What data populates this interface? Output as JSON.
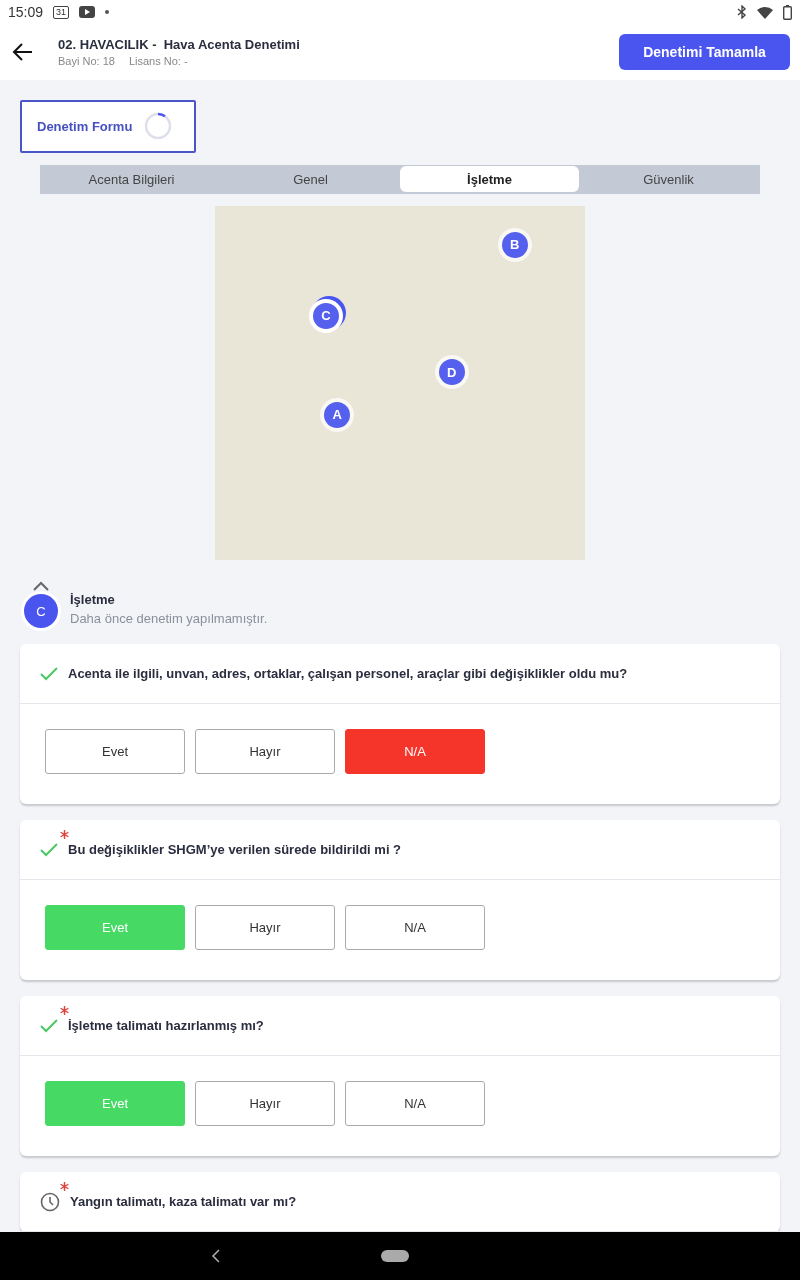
{
  "status_bar": {
    "time": "15:09",
    "calendar_day": "31"
  },
  "header": {
    "title": "02. HAVACILIK -  Hava Acenta Denetimi",
    "bayi": "Bayi No: 18",
    "lisans": "Lisans No: -",
    "action": "Denetimi Tamamla"
  },
  "form_button": {
    "label": "Denetim Formu"
  },
  "tabs": [
    {
      "label": "Acenta Bilgileri",
      "selected": false
    },
    {
      "label": "Genel",
      "selected": false
    },
    {
      "label": "İşletme",
      "selected": true
    },
    {
      "label": "Güvenlik",
      "selected": false
    }
  ],
  "map": {
    "pins": [
      {
        "label": "B",
        "active": false
      },
      {
        "label": "C",
        "active": true
      },
      {
        "label": "D",
        "active": false
      },
      {
        "label": "A",
        "active": false
      }
    ]
  },
  "section": {
    "title": "İşletme",
    "badge": "C",
    "subtitle": "Daha önce denetim yapılmamıştır.",
    "expanded": true
  },
  "questions": [
    {
      "answered": true,
      "required": false,
      "text": "Acenta ile ilgili, unvan, adres, ortaklar, çalışan personel, araçlar gibi değişiklikler oldu mu?",
      "options": [
        {
          "label": "Evet",
          "selected": false
        },
        {
          "label": "Hayır",
          "selected": false
        },
        {
          "label": "N/A",
          "selected": true
        }
      ]
    },
    {
      "answered": true,
      "required": true,
      "text": "Bu değişiklikler SHGM’ye verilen sürede bildirildi mi ?",
      "options": [
        {
          "label": "Evet",
          "selected": true
        },
        {
          "label": "Hayır",
          "selected": false
        },
        {
          "label": "N/A",
          "selected": false
        }
      ]
    },
    {
      "answered": true,
      "required": true,
      "text": "İşletme talimatı hazırlanmış mı?",
      "options": [
        {
          "label": "Evet",
          "selected": true
        },
        {
          "label": "Hayır",
          "selected": false
        },
        {
          "label": "N/A",
          "selected": false
        }
      ]
    },
    {
      "answered": false,
      "required": true,
      "text": "Yangın talimatı, kaza talimatı var mı?"
    }
  ]
}
